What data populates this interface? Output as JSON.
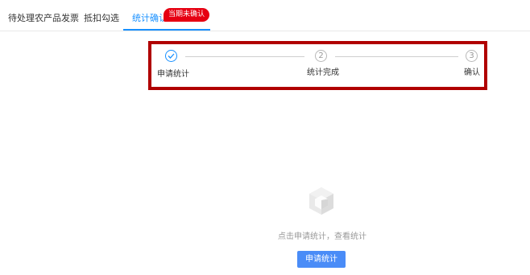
{
  "tabs": [
    {
      "label": "待处理农产品发票",
      "active": false
    },
    {
      "label": "抵扣勾选",
      "active": false
    },
    {
      "label": "统计确认",
      "active": true,
      "badge": "当期未确认"
    }
  ],
  "steps": [
    {
      "number": "",
      "label": "申请统计",
      "status": "done"
    },
    {
      "number": "2",
      "label": "统计完成",
      "status": "wait"
    },
    {
      "number": "3",
      "label": "确认",
      "status": "wait"
    }
  ],
  "empty_state": {
    "icon": "cube-box-icon",
    "message": "点击申请统计，查看统计",
    "button_label": "申请统计"
  },
  "colors": {
    "accent": "#1890ff",
    "badge": "#e60012",
    "highlight_border": "#b00000",
    "button": "#4a8cf7"
  }
}
